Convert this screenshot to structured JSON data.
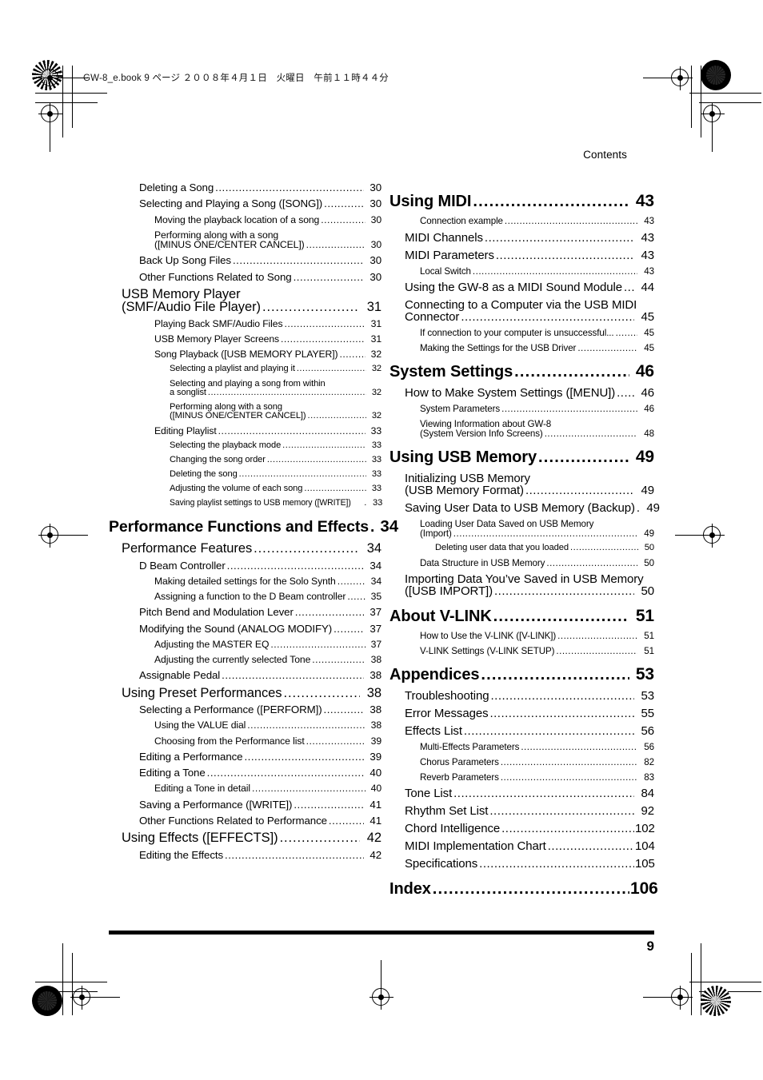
{
  "print_header": "GW-8_e.book  9 ページ  ２００８年４月１日　火曜日　午前１１時４４分",
  "running_head": "Contents",
  "folio": "9",
  "columns": [
    {
      "name": "left",
      "entries": [
        {
          "level": 2,
          "title": "Deleting a Song",
          "page": "30"
        },
        {
          "level": 2,
          "title": "Selecting and Playing a Song ([SONG])",
          "page": "30"
        },
        {
          "level": 3,
          "title": "Moving the playback location of a song",
          "page": "30"
        },
        {
          "level": 3,
          "title": "Performing along with a song",
          "title2": "([MINUS ONE/CENTER CANCEL])",
          "page": "30"
        },
        {
          "level": 2,
          "title": "Back Up Song Files",
          "page": "30"
        },
        {
          "level": 2,
          "title": "Other Functions Related to Song",
          "page": "30"
        },
        {
          "level": "1b",
          "title": "USB Memory Player",
          "title2": "(SMF/Audio File Player)",
          "page": "31"
        },
        {
          "level": 3,
          "title": "Playing Back SMF/Audio Files",
          "page": "31"
        },
        {
          "level": 3,
          "title": "USB Memory Player Screens",
          "page": "31"
        },
        {
          "level": 3,
          "title": "Song Playback ([USB MEMORY PLAYER])",
          "page": "32"
        },
        {
          "level": 4,
          "title": "Selecting a playlist and playing it",
          "page": "32"
        },
        {
          "level": 4,
          "title": "Selecting and playing a song from within",
          "title2": "a songlist",
          "page": "32"
        },
        {
          "level": 4,
          "title": "Performing along with a song",
          "title2": "([MINUS ONE/CENTER CANCEL])",
          "page": "32"
        },
        {
          "level": 3,
          "title": "Editing Playlist",
          "page": "33"
        },
        {
          "level": 4,
          "title": "Selecting the playback mode",
          "page": "33"
        },
        {
          "level": 4,
          "title": "Changing the song order",
          "page": "33"
        },
        {
          "level": 4,
          "title": "Deleting the song",
          "page": "33"
        },
        {
          "level": 4,
          "title": "Adjusting the volume of each song",
          "page": "33"
        },
        {
          "level": 4,
          "title": "Saving playlist settings to USB memory ([WRITE])",
          "page": "33",
          "condensed": true
        },
        {
          "level": 1,
          "title": "Performance Functions and Effects",
          "page": "34"
        },
        {
          "level": "1b",
          "title": "Performance Features",
          "page": "34"
        },
        {
          "level": 2,
          "title": "D Beam Controller",
          "page": "34"
        },
        {
          "level": 3,
          "title": "Making detailed settings for the Solo Synth",
          "page": "34"
        },
        {
          "level": 3,
          "title": "Assigning a function to the D Beam controller",
          "page": "35"
        },
        {
          "level": 2,
          "title": "Pitch Bend and Modulation Lever",
          "page": "37"
        },
        {
          "level": 2,
          "title": "Modifying the Sound (ANALOG MODIFY)",
          "page": "37"
        },
        {
          "level": 3,
          "title": "Adjusting the MASTER EQ",
          "page": "37"
        },
        {
          "level": 3,
          "title": "Adjusting the currently selected Tone",
          "page": "38"
        },
        {
          "level": 2,
          "title": "Assignable Pedal",
          "page": "38"
        },
        {
          "level": "1b",
          "title": "Using Preset Performances",
          "page": "38"
        },
        {
          "level": 2,
          "title": "Selecting a Performance ([PERFORM])",
          "page": "38"
        },
        {
          "level": 3,
          "title": "Using the VALUE dial",
          "page": "38"
        },
        {
          "level": 3,
          "title": "Choosing from the Performance list",
          "page": "39"
        },
        {
          "level": 2,
          "title": "Editing a Performance",
          "page": "39"
        },
        {
          "level": 2,
          "title": "Editing a Tone",
          "page": "40"
        },
        {
          "level": 3,
          "title": "Editing a Tone in detail",
          "page": "40"
        },
        {
          "level": 2,
          "title": "Saving a Performance ([WRITE])",
          "page": "41"
        },
        {
          "level": 2,
          "title": "Other Functions Related to Performance",
          "page": "41"
        },
        {
          "level": "1b",
          "title": "Using Effects ([EFFECTS])",
          "page": "42"
        },
        {
          "level": 2,
          "title": "Editing the Effects",
          "page": "42"
        }
      ]
    },
    {
      "name": "right",
      "entries": [
        {
          "level": 1,
          "title": "Using MIDI",
          "page": "43"
        },
        {
          "level": 3,
          "title": "Connection example",
          "page": "43"
        },
        {
          "level": 2,
          "title": "MIDI Channels",
          "page": "43"
        },
        {
          "level": 2,
          "title": "MIDI Parameters",
          "page": "43"
        },
        {
          "level": 3,
          "title": "Local Switch",
          "page": "43"
        },
        {
          "level": 2,
          "title": "Using the GW-8 as a MIDI Sound Module",
          "page": "44"
        },
        {
          "level": 2,
          "title": "Connecting to a Computer via the USB MIDI",
          "title2": "Connector",
          "page": "45"
        },
        {
          "level": 3,
          "title": "If connection to your computer is unsuccessful...",
          "page": "45"
        },
        {
          "level": 3,
          "title": "Making the Settings for the USB Driver",
          "page": "45"
        },
        {
          "level": 1,
          "title": "System Settings",
          "page": "46"
        },
        {
          "level": 2,
          "title": "How to Make System Settings ([MENU])",
          "page": "46"
        },
        {
          "level": 3,
          "title": "System Parameters",
          "page": "46"
        },
        {
          "level": 3,
          "title": "Viewing Information about GW-8",
          "title2": "(System Version Info Screens)",
          "page": "48"
        },
        {
          "level": 1,
          "title": "Using USB Memory",
          "page": "49"
        },
        {
          "level": 2,
          "title": "Initializing USB Memory",
          "title2": "(USB Memory Format)",
          "page": "49"
        },
        {
          "level": 2,
          "title": "Saving User Data to USB Memory (Backup)",
          "page": "49"
        },
        {
          "level": 3,
          "title": "Loading User Data Saved on USB Memory",
          "title2": "(Import)",
          "page": "49"
        },
        {
          "level": 4,
          "title": "Deleting user data that you loaded",
          "page": "50"
        },
        {
          "level": 3,
          "title": "Data Structure in USB Memory",
          "page": "50"
        },
        {
          "level": 2,
          "title": "Importing Data You’ve Saved in USB Memory",
          "title2": "([USB IMPORT])",
          "page": "50"
        },
        {
          "level": 1,
          "title": "About V-LINK",
          "page": "51"
        },
        {
          "level": 3,
          "title": "How to Use the V-LINK ([V-LINK])",
          "page": "51"
        },
        {
          "level": 3,
          "title": "V-LINK Settings (V-LINK SETUP)",
          "page": "51"
        },
        {
          "level": 1,
          "title": "Appendices",
          "page": "53"
        },
        {
          "level": 2,
          "title": "Troubleshooting",
          "page": "53"
        },
        {
          "level": 2,
          "title": "Error Messages",
          "page": "55"
        },
        {
          "level": 2,
          "title": "Effects List",
          "page": "56"
        },
        {
          "level": 3,
          "title": "Multi-Effects Parameters",
          "page": "56"
        },
        {
          "level": 3,
          "title": "Chorus Parameters",
          "page": "82"
        },
        {
          "level": 3,
          "title": "Reverb Parameters",
          "page": "83"
        },
        {
          "level": 2,
          "title": "Tone List",
          "page": "84"
        },
        {
          "level": 2,
          "title": "Rhythm Set List",
          "page": "92"
        },
        {
          "level": 2,
          "title": "Chord Intelligence",
          "page": "102"
        },
        {
          "level": 2,
          "title": "MIDI Implementation Chart",
          "page": "104"
        },
        {
          "level": 2,
          "title": "Specifications",
          "page": "105"
        },
        {
          "level": 1,
          "title": "Index",
          "page": "106"
        }
      ]
    }
  ]
}
